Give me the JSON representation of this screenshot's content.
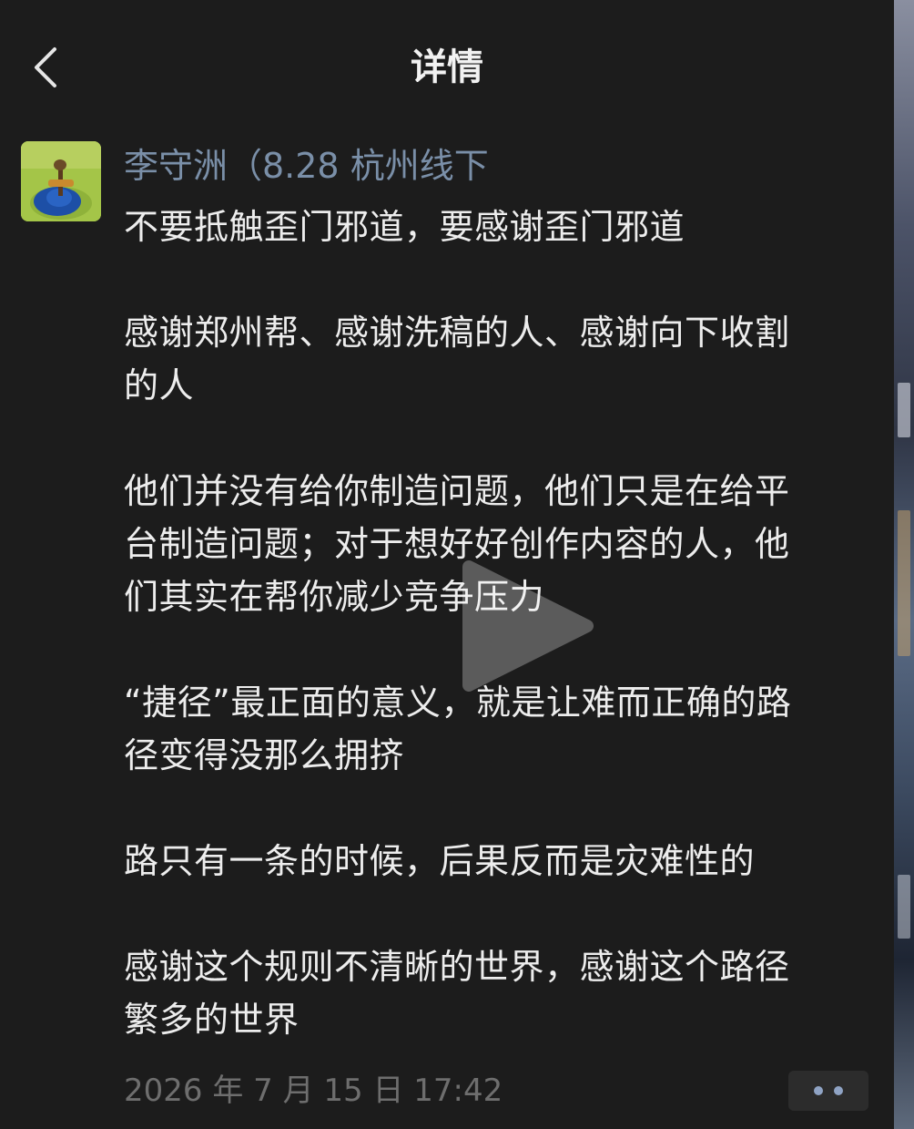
{
  "nav": {
    "title": "详情",
    "back_icon": "chevron-left-icon"
  },
  "post": {
    "author": "李守洲（8.28 杭州线下",
    "avatar_icon": "user-avatar-image",
    "paragraphs": [
      [
        "不要抵触歪门邪道，要感谢歪门邪道"
      ],
      [
        "感谢郑州帮、感谢洗稿的人、感谢向下收割",
        "的人"
      ],
      [
        "他们并没有给你制造问题，他们只是在给平",
        "台制造问题；对于想好好创作内容的人，他",
        "们其实在帮你减少竞争压力"
      ],
      [
        "“捷径”最正面的意义，就是让难而正确的路",
        "径变得没那么拥挤"
      ],
      [
        "路只有一条的时候，后果反而是灾难性的"
      ],
      [
        "感谢这个规则不清晰的世界，感谢这个路径",
        "繁多的世界"
      ]
    ],
    "timestamp": "2026 年 7 月 15 日  17:42",
    "more_icon": "more-options-icon"
  },
  "overlay": {
    "play_icon": "play-icon"
  },
  "colors": {
    "background": "#1c1c1c",
    "author": "#7a8fa8",
    "body_text": "#ededed",
    "timestamp": "#6e6e6e",
    "more_dots": "#8fa3c4"
  }
}
